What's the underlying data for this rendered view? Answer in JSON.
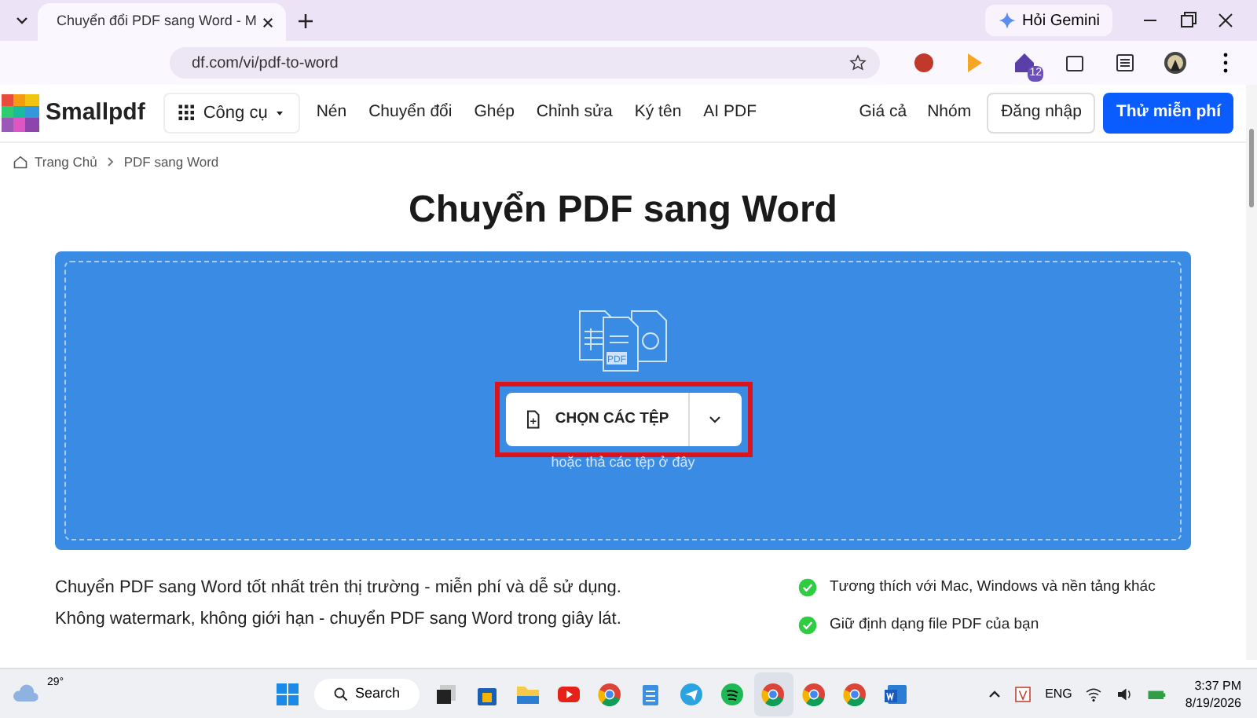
{
  "browser": {
    "tab": {
      "title": "Chuyển đổi PDF sang Word - M",
      "selected": true
    },
    "gemini": "Hỏi Gemini",
    "address": "df.com/vi/pdf-to-word",
    "extension_badge": "12"
  },
  "nav": {
    "logo": "Smallpdf",
    "tools": "Công cụ",
    "links": [
      "Nén",
      "Chuyển đổi",
      "Ghép",
      "Chỉnh sửa",
      "Ký tên",
      "AI PDF"
    ],
    "right_links": [
      "Giá cả",
      "Nhóm"
    ],
    "login": "Đăng nhập",
    "trial": "Thử miễn phí"
  },
  "breadcrumbs": [
    "Trang Chủ",
    "PDF sang Word"
  ],
  "title": "Chuyển PDF sang Word",
  "dropzone": {
    "doc_label": "PDF",
    "button": "CHỌN CÁC TỆP",
    "hint": "hoặc thả các tệp ở đây",
    "highlighted": true
  },
  "description": "Chuyển PDF sang Word tốt nhất trên thị trường - miễn phí và dễ sử dụng. Không watermark, không giới hạn - chuyển PDF sang Word trong giây lát.",
  "features": [
    "Tương thích với Mac, Windows và nền tảng khác",
    "Giữ định dạng file PDF của bạn"
  ],
  "taskbar": {
    "weather": "29°",
    "search": "Search",
    "language": "ENG",
    "time": "3:37 PM",
    "date": "8/19/2026"
  }
}
